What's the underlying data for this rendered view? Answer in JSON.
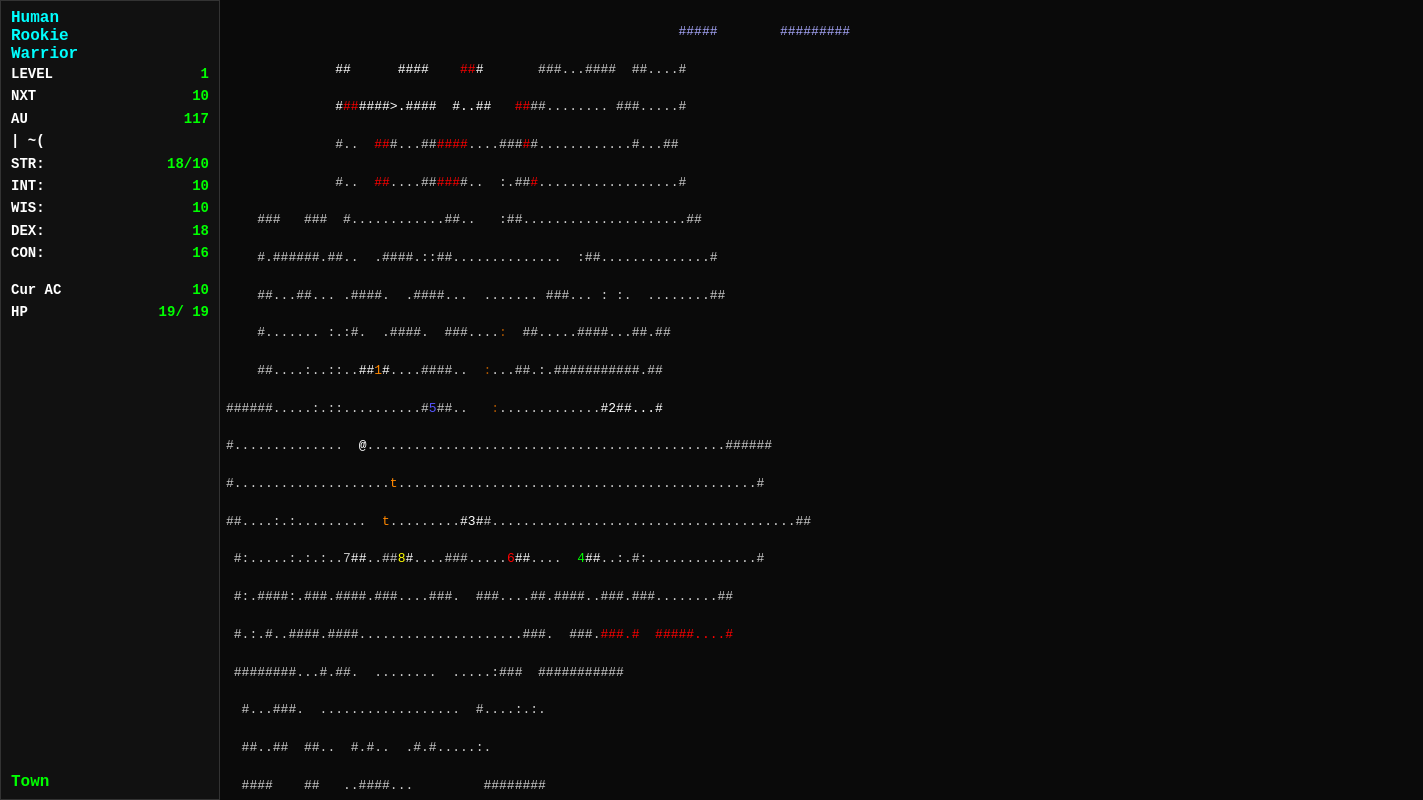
{
  "sidebar": {
    "human": "Human",
    "rookie": "Rookie",
    "warrior": "Warrior",
    "level_label": "LEVEL",
    "level_val": "1",
    "nxt_label": "NXT",
    "nxt_val": "10",
    "au_label": "AU",
    "au_val": "117",
    "symbol_row": "|      ~(",
    "str_label": "STR:",
    "str_val": "18/10",
    "int_label": "INT:",
    "int_val": "10",
    "wis_label": "WIS:",
    "wis_val": "10",
    "dex_label": "DEX:",
    "dex_val": "18",
    "con_label": "CON:",
    "con_val": "16",
    "curac_label": "Cur AC",
    "curac_val": "10",
    "hp_label": "HP",
    "hp_val": "19/   19",
    "town_label": "Town"
  }
}
